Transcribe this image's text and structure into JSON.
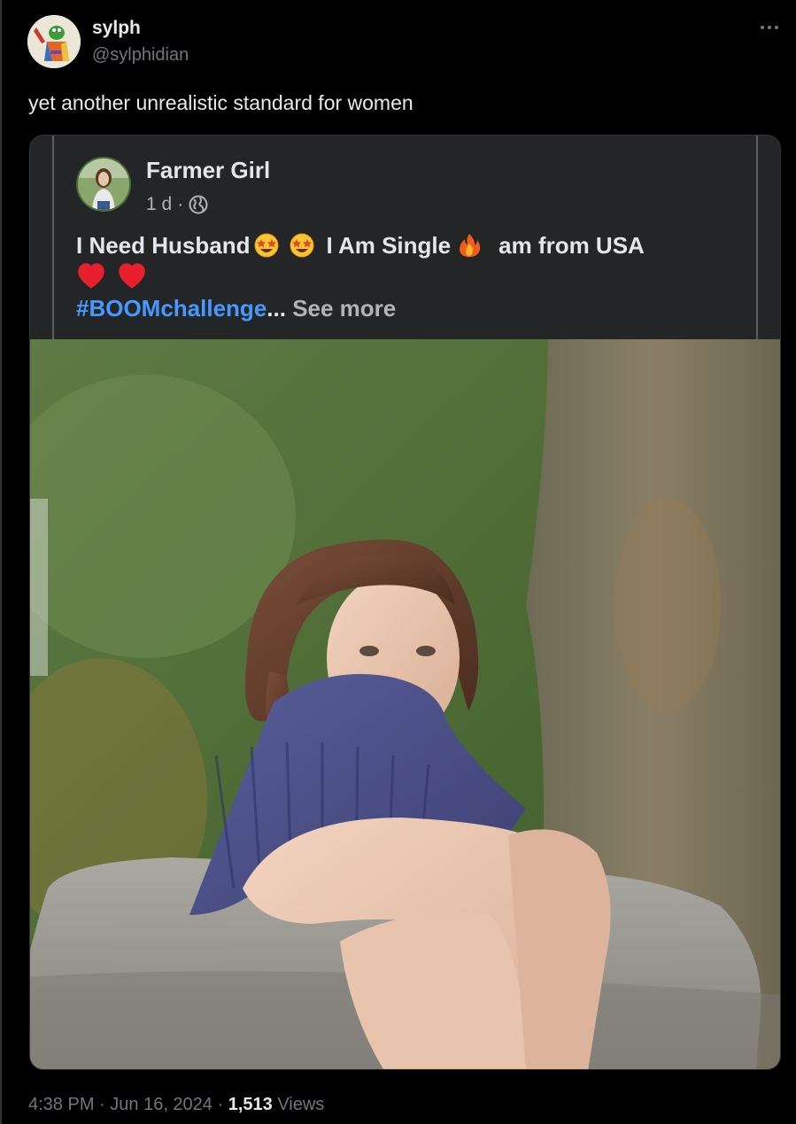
{
  "tweet": {
    "author": {
      "display_name": "sylph",
      "handle": "@sylphidian"
    },
    "text": "yet another unrealistic standard for women",
    "time": "4:38 PM",
    "sep1": " · ",
    "date": "Jun 16, 2024",
    "sep2": " · ",
    "views_count": "1,513",
    "views_label": " Views"
  },
  "embedded_post": {
    "author_name": "Farmer Girl",
    "age": "1 d",
    "age_sep": "·",
    "audience_icon": "globe-icon",
    "line1_a": "I Need Husband",
    "line1_b": "I Am Single",
    "line1_c": "am from USA",
    "hashtag": "#BOOMchallenge",
    "ellipsis": "...",
    "see_more": "See more",
    "emojis": [
      "star-struck-emoji",
      "star-struck-emoji",
      "fire-emoji",
      "red-heart-emoji",
      "red-heart-emoji"
    ]
  },
  "colors": {
    "background": "#000000",
    "text_primary": "#e7e9ea",
    "text_secondary": "#71767b",
    "fb_card": "#242526",
    "fb_hashtag": "#4599ff"
  }
}
